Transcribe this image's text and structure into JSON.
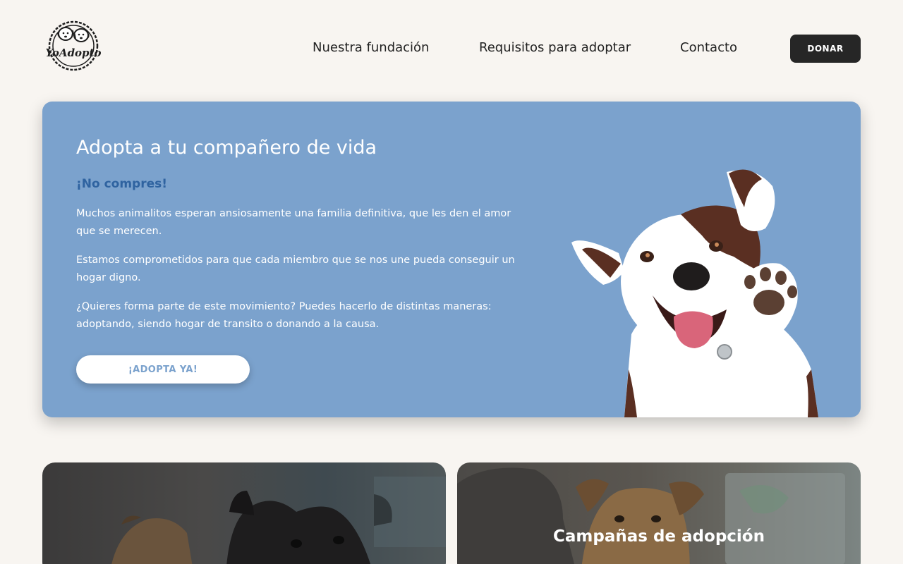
{
  "brand": {
    "logo_text": "YoAdopto"
  },
  "nav": {
    "items": [
      "Nuestra fundación",
      "Requisitos para adoptar",
      "Contacto"
    ],
    "donate_label": "DONAR"
  },
  "hero": {
    "title": "Adopta a tu compañero de vida",
    "subtitle": "¡No compres!",
    "paragraphs": [
      "Muchos animalitos esperan ansiosamente una familia definitiva, que les den el amor que se merecen.",
      "Estamos comprometidos para que cada miembro que se nos une pueda conseguir un hogar digno.",
      "¿Quieres forma parte de este movimiento? Puedes hacerlo de distintas maneras: adoptando, siendo hogar de transito o donando a la causa."
    ],
    "cta_label": "¡ADOPTA YA!"
  },
  "cards": [
    {
      "title": ""
    },
    {
      "title": "Campañas de adopción"
    }
  ],
  "colors": {
    "background": "#f8f5f1",
    "hero": "#7ba2cd",
    "subtitle": "#2f63a0",
    "dark_button": "#262626"
  }
}
